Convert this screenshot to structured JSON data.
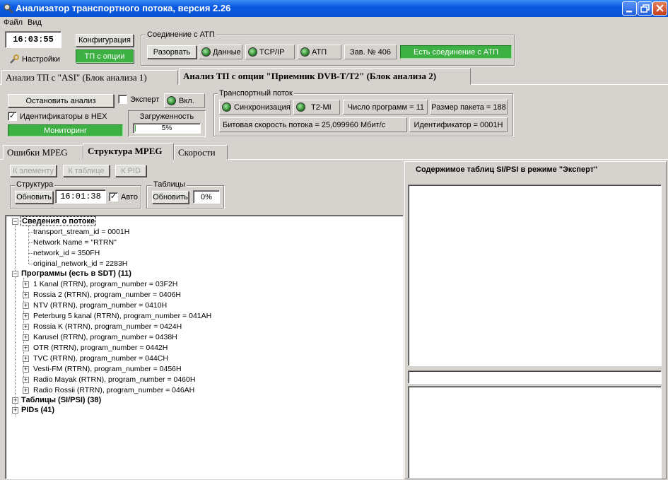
{
  "window": {
    "title": "Анализатор транспортного потока, версия 2.26",
    "minimize_icon": "minimize-icon",
    "maximize_icon": "restore-icon",
    "close_icon": "close-icon"
  },
  "menu": {
    "items": [
      "Файл",
      "Вид"
    ]
  },
  "top": {
    "clock": "16:03:55",
    "settings_label": "Настройки",
    "config_button": "Конфигурация",
    "tp_button": "ТП с опции"
  },
  "connection": {
    "group_label": "Соединение с АТП",
    "disconnect_button": "Разорвать",
    "led_data": "Данные",
    "led_tcp": "TCP/IP",
    "led_atp": "АТП",
    "serial": "Зав. № 406",
    "status": "Есть соединение с АТП"
  },
  "main_tabs": [
    "Анализ ТП с \"ASI\" (Блок анализа 1)",
    "Анализ ТП с опции \"Приемник DVB-T/T2\" (Блок анализа 2)"
  ],
  "analysis": {
    "stop_button": "Остановить анализ",
    "expert_label": "Эксперт",
    "expert_checked": false,
    "on_label": "Вкл.",
    "hex_label": "Идентификаторы в HEX",
    "hex_checked": true,
    "monitoring": "Мониторинг",
    "load_label": "Загруженность",
    "load_value": "5%",
    "load_fraction": 0.05
  },
  "transport": {
    "group_label": "Транспортный поток",
    "sync_label": "Синхронизация",
    "t2mi_label": "T2-MI",
    "programs": "Число программ = 11",
    "packet_size": "Размер пакета = 188",
    "bitrate": "Битовая скорость потока = 25,099960 Мбит/с",
    "identifier": "Идентификатор = 0001H"
  },
  "sub_tabs": [
    "Ошибки MPEG",
    "Структура MPEG",
    "Скорости"
  ],
  "nav_buttons": [
    "К элементу",
    "К таблице",
    "К PID"
  ],
  "structure": {
    "group_label": "Структура",
    "refresh_button": "Обновить",
    "time": "16:01:38",
    "auto_label": "Авто",
    "auto_checked": true
  },
  "tables": {
    "group_label": "Таблицы",
    "refresh_button": "Обновить",
    "percent": "0%"
  },
  "tree": {
    "stream_info": {
      "label": "Сведения о потоке",
      "children": [
        "transport_stream_id = 0001H",
        "Network Name = \"RTRN\"",
        "network_id = 350FH",
        "original_network_id = 2283H"
      ]
    },
    "programs": {
      "label": "Программы (есть в SDT) (11)",
      "children": [
        "1 Kanal (RTRN),  program_number = 03F2H",
        "Rossia 2 (RTRN),  program_number = 0406H",
        "NTV (RTRN),  program_number = 0410H",
        "Peterburg 5 kanal (RTRN),  program_number = 041AH",
        "Rossia K (RTRN),  program_number = 0424H",
        "Karusel (RTRN),  program_number = 0438H",
        "OTR (RTRN),  program_number = 0442H",
        "TVC (RTRN),  program_number = 044CH",
        "Vesti-FM (RTRN),  program_number = 0456H",
        "Radio Mayak (RTRN),  program_number = 0460H",
        "Radio Rossii (RTRN),  program_number = 046AH"
      ]
    },
    "tables_node": "Таблицы (SI/PSI) (38)",
    "pids_node": "PIDs (41)"
  },
  "right_panel": {
    "title": "Содержимое таблиц SI/PSI в режиме \"Эксперт\""
  }
}
